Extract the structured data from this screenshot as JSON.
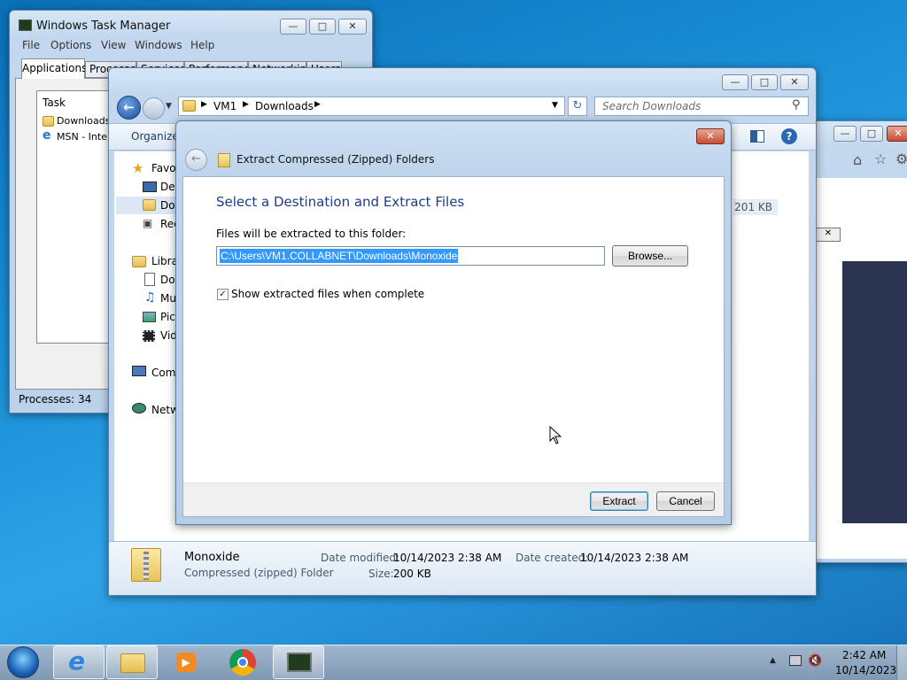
{
  "task_manager": {
    "title": "Windows Task Manager",
    "menu": [
      "File",
      "Options",
      "View",
      "Windows",
      "Help"
    ],
    "tabs": [
      "Applications",
      "Processes",
      "Services",
      "Performance",
      "Networking",
      "Users"
    ],
    "column_task": "Task",
    "tasks": [
      "Downloads",
      "MSN - Internet Explorer"
    ],
    "status": "Processes: 34"
  },
  "explorer": {
    "breadcrumb": [
      "VM1",
      "Downloads"
    ],
    "search_placeholder": "Search Downloads",
    "organize": "Organize",
    "nav": {
      "favorites": "Favorites",
      "desktop": "Desktop",
      "downloads": "Downloads",
      "recent": "Recent Places",
      "libraries": "Libraries",
      "documents": "Documents",
      "music": "Music",
      "pictures": "Pictures",
      "videos": "Videos",
      "computer": "Computer",
      "network": "Network"
    },
    "file_size_col": "201 KB",
    "details": {
      "name": "Monoxide",
      "type": "Compressed (zipped) Folder",
      "date_modified_label": "Date modified:",
      "date_modified": "10/14/2023 2:38 AM",
      "date_created_label": "Date created:",
      "date_created": "10/14/2023 2:38 AM",
      "size_label": "Size:",
      "size": "200 KB"
    }
  },
  "dialog": {
    "title": "Extract Compressed (Zipped) Folders",
    "heading": "Select a Destination and Extract Files",
    "path_label": "Files will be extracted to this folder:",
    "path_value": "C:\\Users\\VM1.COLLABNET\\Downloads\\Monoxide",
    "browse": "Browse...",
    "checkbox_label": "Show extracted files when complete",
    "checkbox_checked": true,
    "extract": "Extract",
    "cancel": "Cancel"
  },
  "taskbar": {
    "time": "2:42 AM",
    "date": "10/14/2023",
    "apps": [
      "start-orb",
      "internet-explorer",
      "windows-explorer",
      "media-player",
      "chrome",
      "task-manager"
    ]
  }
}
